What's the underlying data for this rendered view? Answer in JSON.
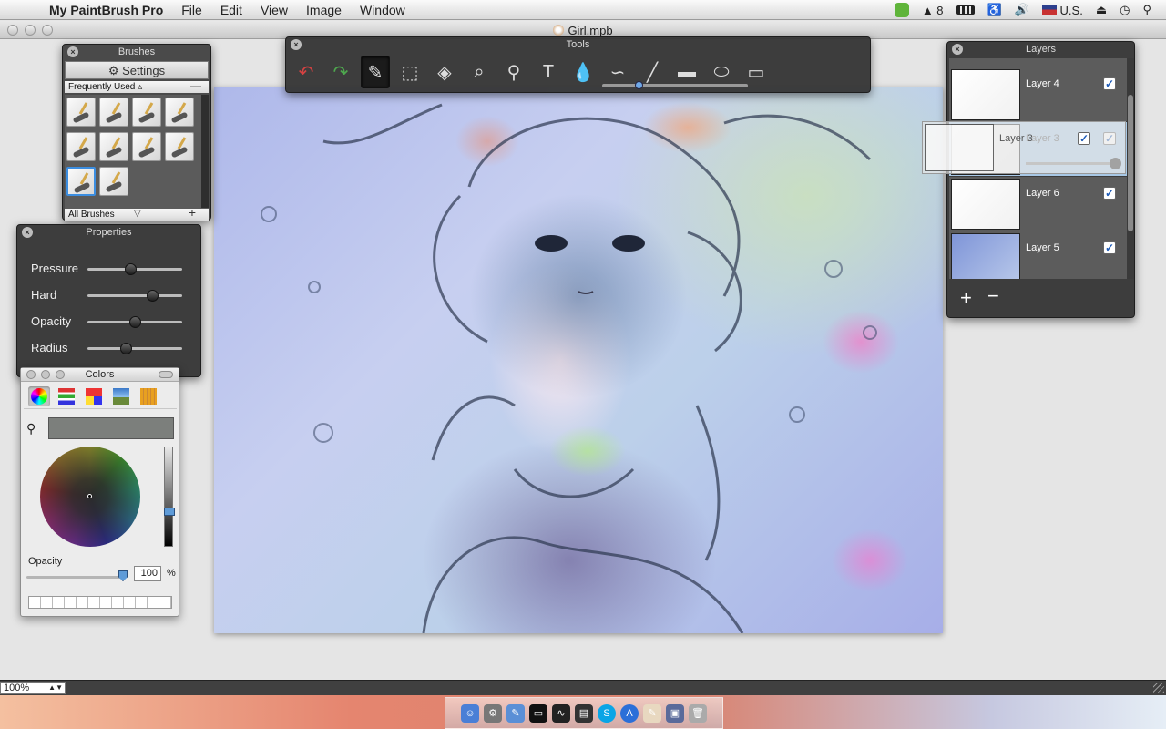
{
  "menubar": {
    "app_name": "My PaintBrush Pro",
    "menus": [
      "File",
      "Edit",
      "View",
      "Image",
      "Window"
    ],
    "status": {
      "notifications": "8",
      "input_source": "U.S."
    }
  },
  "window": {
    "title": "Girl.mpb"
  },
  "tools": {
    "title": "Tools",
    "items": [
      {
        "name": "undo",
        "glyph": "↶"
      },
      {
        "name": "redo",
        "glyph": "↷"
      },
      {
        "name": "brush",
        "glyph": "✎"
      },
      {
        "name": "select",
        "glyph": "⬚"
      },
      {
        "name": "fill",
        "glyph": "◈"
      },
      {
        "name": "eyedropper",
        "glyph": "⌕"
      },
      {
        "name": "zoom",
        "glyph": "⚲"
      },
      {
        "name": "text",
        "glyph": "T"
      },
      {
        "name": "drop",
        "glyph": "💧"
      },
      {
        "name": "curve",
        "glyph": "∽"
      },
      {
        "name": "line",
        "glyph": "╱"
      },
      {
        "name": "rectangle",
        "glyph": "▬"
      },
      {
        "name": "ellipse",
        "glyph": "⬭"
      },
      {
        "name": "rounded-rect",
        "glyph": "▭"
      }
    ],
    "stroke_width": 0.25
  },
  "brushes": {
    "title": "Brushes",
    "settings_label": "Settings",
    "group_label": "Frequently Used",
    "footer_label": "All Brushes",
    "items": [
      "brush-1",
      "brush-2",
      "brush-3",
      "brush-4",
      "brush-5",
      "brush-6",
      "brush-7",
      "brush-8",
      "brush-9",
      "brush-10"
    ],
    "selected": 8
  },
  "properties": {
    "title": "Properties",
    "sliders": [
      {
        "label": "Pressure",
        "value": 0.45
      },
      {
        "label": "Hard",
        "value": 0.68
      },
      {
        "label": "Opacity",
        "value": 0.5
      },
      {
        "label": "Radius",
        "value": 0.4
      }
    ]
  },
  "colors": {
    "title": "Colors",
    "opacity_label": "Opacity",
    "opacity_value": "100",
    "opacity_unit": "%",
    "current_color": "#7c7f7c"
  },
  "layers": {
    "title": "Layers",
    "items": [
      {
        "name": "Layer 4",
        "visible": true,
        "selected": false
      },
      {
        "name": "Layer 3",
        "visible": true,
        "selected": true
      },
      {
        "name": "Layer 6",
        "visible": true,
        "selected": false
      },
      {
        "name": "Layer 5",
        "visible": true,
        "selected": false
      }
    ],
    "drag_ghost_name": "Layer 3",
    "add_label": "+",
    "remove_label": "−"
  },
  "statusbar": {
    "zoom": "100%"
  }
}
